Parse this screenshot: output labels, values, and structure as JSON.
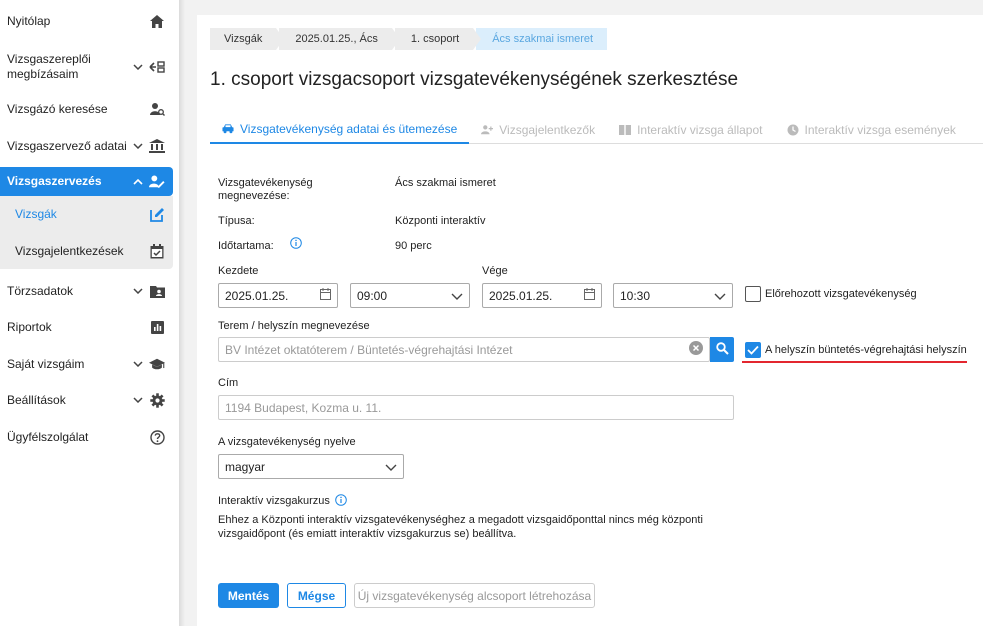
{
  "sidebar": {
    "items": [
      {
        "label": "Nyitólap",
        "icon": "home-icon"
      },
      {
        "label": "Vizsgaszereplői megbízásaim",
        "icon": "assignment-icon"
      },
      {
        "label": "Vizsgázó keresése",
        "icon": "person-search-icon"
      },
      {
        "label": "Vizsgaszervező adatai",
        "icon": "institution-icon"
      },
      {
        "label": "Vizsgaszervezés",
        "icon": "person-edit-icon"
      },
      {
        "label": "Törzsadatok",
        "icon": "contact-card-icon"
      },
      {
        "label": "Riportok",
        "icon": "report-icon"
      },
      {
        "label": "Saját vizsgáim",
        "icon": "graduation-cap-icon"
      },
      {
        "label": "Beállítások",
        "icon": "gear-icon"
      },
      {
        "label": "Ügyfélszolgálat",
        "icon": "help-icon"
      }
    ],
    "sub_items": [
      {
        "label": "Vizsgák",
        "icon": "edit-icon"
      },
      {
        "label": "Vizsgajelentkezések",
        "icon": "calendar-check-icon"
      }
    ]
  },
  "breadcrumb": [
    "Vizsgák",
    "2025.01.25., Ács",
    "1. csoport",
    "Ács szakmai ismeret"
  ],
  "page_title": "1. csoport vizsgacsoport vizsgatevékenységének szerkesztése",
  "tabs": [
    {
      "label": "Vizsgatevékenység adatai és ütemezése",
      "icon": "car-icon"
    },
    {
      "label": "Vizsgajelentkezők",
      "icon": "person-add-icon"
    },
    {
      "label": "Interaktív vizsga állapot",
      "icon": "columns-icon"
    },
    {
      "label": "Interaktív vizsga események",
      "icon": "clock-icon"
    }
  ],
  "form": {
    "activity_name_label": "Vizsgatevékenység megnevezése:",
    "activity_name_value": "Ács szakmai ismeret",
    "type_label": "Típusa:",
    "type_value": "Központi interaktív",
    "duration_label": "Időtartama:",
    "duration_value": "90 perc",
    "start_label": "Kezdete",
    "start_date": "2025.01.25.",
    "start_time": "09:00",
    "end_label": "Vége",
    "end_date": "2025.01.25.",
    "end_time": "10:30",
    "brought_forward_label": "Előrehozott vizsgatevékenység",
    "room_label": "Terem / helyszín megnevezése",
    "room_value": "BV Intézet oktatóterem / Büntetés-végrehajtási Intézet",
    "prison_location_label": "A helyszín büntetés-végrehajtási helyszín",
    "address_label": "Cím",
    "address_value": "1194 Budapest, Kozma u. 11.",
    "language_label": "A vizsgatevékenység nyelve",
    "language_value": "magyar",
    "course_label": "Interaktív vizsgakurzus",
    "course_text": "Ehhez a Központi interaktív vizsgatevékenységhez a megadott vizsgaidőponttal nincs még központi vizsgaidőpont (és emiatt interaktív vizsgakurzus se) beállítva."
  },
  "buttons": {
    "save": "Mentés",
    "cancel": "Mégse",
    "new_subgroup": "Új vizsgatevékenység alcsoport létrehozása"
  },
  "colors": {
    "accent": "#1e88e5",
    "underline": "#e3262f"
  }
}
